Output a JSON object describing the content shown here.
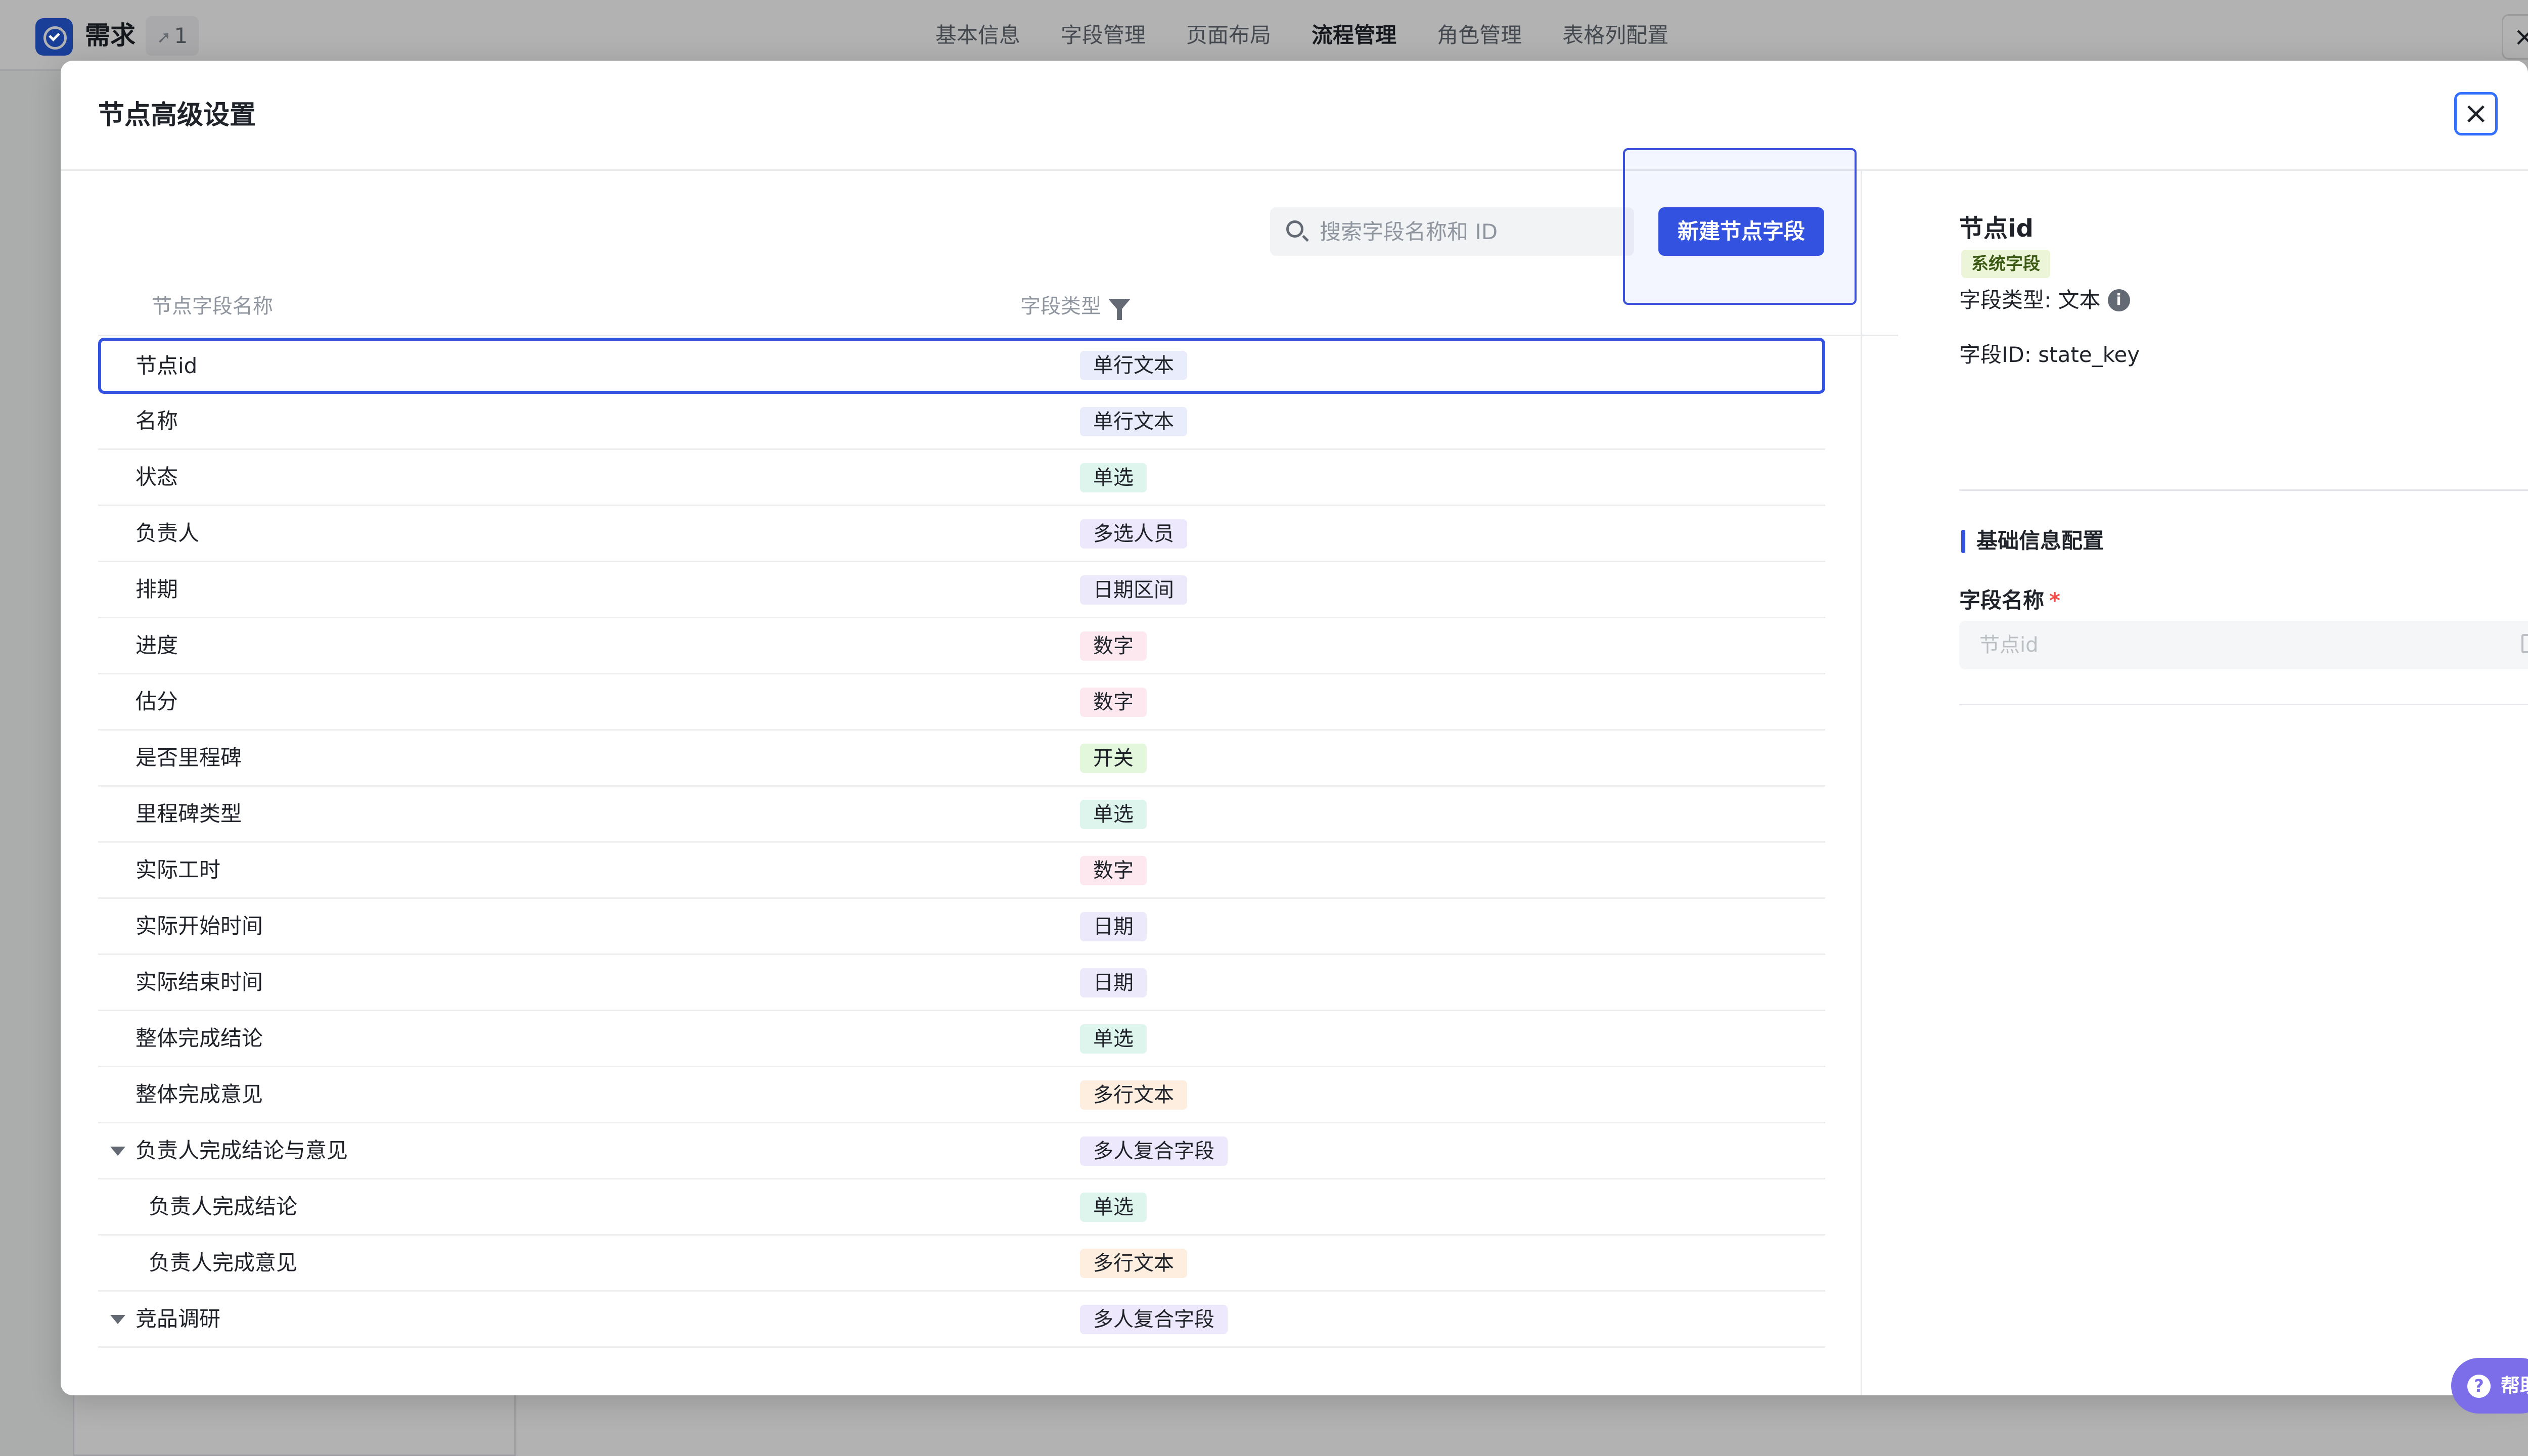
{
  "app": {
    "title": "需求",
    "share_count": "1"
  },
  "nav": {
    "tabs": [
      "基本信息",
      "字段管理",
      "页面布局",
      "流程管理",
      "角色管理",
      "表格列配置"
    ],
    "active_index": 3
  },
  "modal": {
    "title": "节点高级设置",
    "search_placeholder": "搜索字段名称和 ID",
    "new_button": "新建节点字段",
    "columns": {
      "name": "节点字段名称",
      "type": "字段类型"
    },
    "rows": [
      {
        "name": "节点id",
        "type": "单行文本",
        "color": "#e9ecfb",
        "selected": true
      },
      {
        "name": "名称",
        "type": "单行文本",
        "color": "#e9ecfb"
      },
      {
        "name": "状态",
        "type": "单选",
        "color": "#def5ee"
      },
      {
        "name": "负责人",
        "type": "多选人员",
        "color": "#ede8fb"
      },
      {
        "name": "排期",
        "type": "日期区间",
        "color": "#ece9fb"
      },
      {
        "name": "进度",
        "type": "数字",
        "color": "#fde8ef"
      },
      {
        "name": "估分",
        "type": "数字",
        "color": "#fde8ef"
      },
      {
        "name": "是否里程碑",
        "type": "开关",
        "color": "#e2f7dc"
      },
      {
        "name": "里程碑类型",
        "type": "单选",
        "color": "#def5ee"
      },
      {
        "name": "实际工时",
        "type": "数字",
        "color": "#fde8ef"
      },
      {
        "name": "实际开始时间",
        "type": "日期",
        "color": "#ece9fb"
      },
      {
        "name": "实际结束时间",
        "type": "日期",
        "color": "#ece9fb"
      },
      {
        "name": "整体完成结论",
        "type": "单选",
        "color": "#def5ee"
      },
      {
        "name": "整体完成意见",
        "type": "多行文本",
        "color": "#fdeee0"
      },
      {
        "name": "负责人完成结论与意见",
        "type": "多人复合字段",
        "color": "#ede8fb",
        "group": true
      },
      {
        "name": "负责人完成结论",
        "type": "单选",
        "color": "#def5ee",
        "child": true
      },
      {
        "name": "负责人完成意见",
        "type": "多行文本",
        "color": "#fdeee0",
        "child": true
      },
      {
        "name": "竞品调研",
        "type": "多人复合字段",
        "color": "#ede8fb",
        "group": true
      }
    ]
  },
  "detail": {
    "title": "节点id",
    "badge": "系统字段",
    "type_label": "字段类型:",
    "type_value": "文本",
    "id_label": "字段ID:",
    "id_value": "state_key",
    "section_title": "基础信息配置",
    "field_name_label": "字段名称",
    "field_name_placeholder": "节点id"
  },
  "help": {
    "label": "帮助"
  },
  "icons": [
    "check-circle-icon",
    "share-icon",
    "close-icon",
    "search-icon",
    "filter-icon",
    "info-icon",
    "edit-icon",
    "caret-down-icon",
    "help-icon"
  ]
}
